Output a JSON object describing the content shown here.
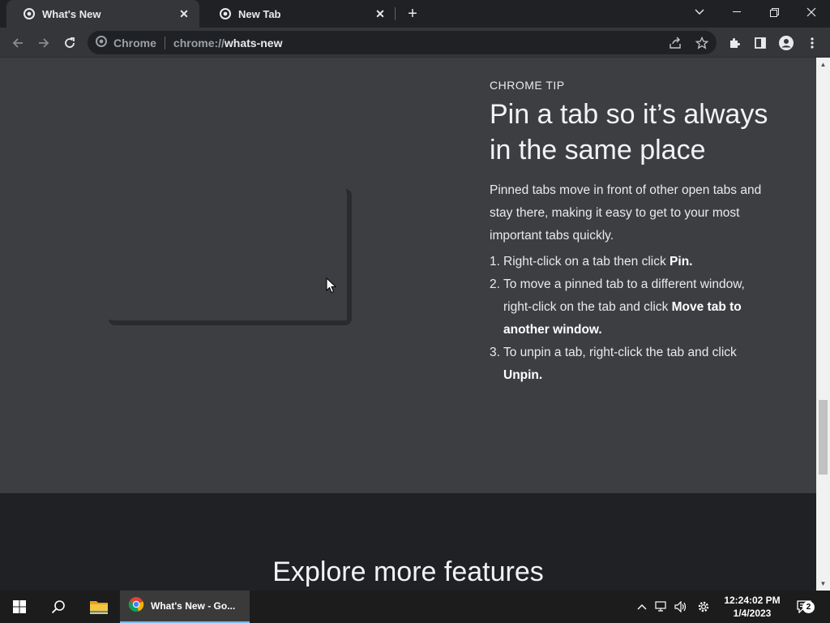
{
  "tabs": [
    {
      "title": "What's New",
      "active": true,
      "favicon": "chrome-icon"
    },
    {
      "title": "New Tab",
      "active": false,
      "favicon": "chrome-icon"
    }
  ],
  "omnibox": {
    "chip_label": "Chrome",
    "url_scheme": "chrome://",
    "url_host": "whats-new"
  },
  "tip": {
    "label": "CHROME TIP",
    "heading": "Pin a tab so it’s always in the same place",
    "body": "Pinned tabs move in front of other open tabs and stay there, making it easy to get to your most important tabs quickly.",
    "steps": [
      {
        "num": "1.",
        "text": "Right-click on a tab then click ",
        "bold": "Pin."
      },
      {
        "num": "2.",
        "text": "To move a pinned tab to a different window, right-click on the tab and click ",
        "bold": "Move tab to another window."
      },
      {
        "num": "3.",
        "text": "To unpin a tab, right-click the tab and click ",
        "bold": "Unpin."
      }
    ]
  },
  "explore_heading": "Explore more features",
  "taskbar": {
    "app_label": "What's New - Go...",
    "time": "12:24:02 PM",
    "date": "1/4/2023",
    "notification_count": "2"
  },
  "colors": {
    "tab_active_bg": "#35363a",
    "content_bg": "#3c3e41",
    "page_bg": "#202124",
    "taskbar_bg": "#1c1c1c"
  }
}
